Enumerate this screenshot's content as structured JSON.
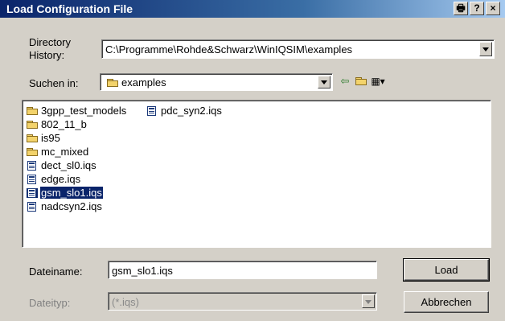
{
  "window": {
    "title": "Load Configuration File",
    "buttons": {
      "print": "🖶",
      "help": "?",
      "close": "×"
    }
  },
  "directory_history": {
    "label_line1": "Directory",
    "label_line2": "History:",
    "value": "C:\\Programme\\Rohde&Schwarz\\WinIQSIM\\examples"
  },
  "look_in": {
    "label": "Suchen in:",
    "value": "examples",
    "icons": [
      "back-arrow-icon",
      "up-folder-icon",
      "view-menu-icon"
    ]
  },
  "files": [
    {
      "name": "3gpp_test_models",
      "type": "folder",
      "selected": false
    },
    {
      "name": "802_11_b",
      "type": "folder",
      "selected": false
    },
    {
      "name": "is95",
      "type": "folder",
      "selected": false
    },
    {
      "name": "mc_mixed",
      "type": "folder",
      "selected": false
    },
    {
      "name": "dect_sl0.iqs",
      "type": "file",
      "selected": false
    },
    {
      "name": "edge.iqs",
      "type": "file",
      "selected": false
    },
    {
      "name": "gsm_slo1.iqs",
      "type": "file",
      "selected": true
    },
    {
      "name": "nadcsyn2.iqs",
      "type": "file",
      "selected": false
    },
    {
      "name": "pdc_syn2.iqs",
      "type": "file",
      "selected": false
    }
  ],
  "filename": {
    "label": "Dateiname:",
    "value": "gsm_slo1.iqs"
  },
  "filetype": {
    "label": "Dateityp:",
    "value": "(*.iqs)"
  },
  "actions": {
    "load": "Load",
    "cancel": "Abbrechen"
  },
  "colors": {
    "titlebar_start": "#0a246a",
    "selection": "#0a246a",
    "dialog_bg": "#d4d0c8"
  }
}
